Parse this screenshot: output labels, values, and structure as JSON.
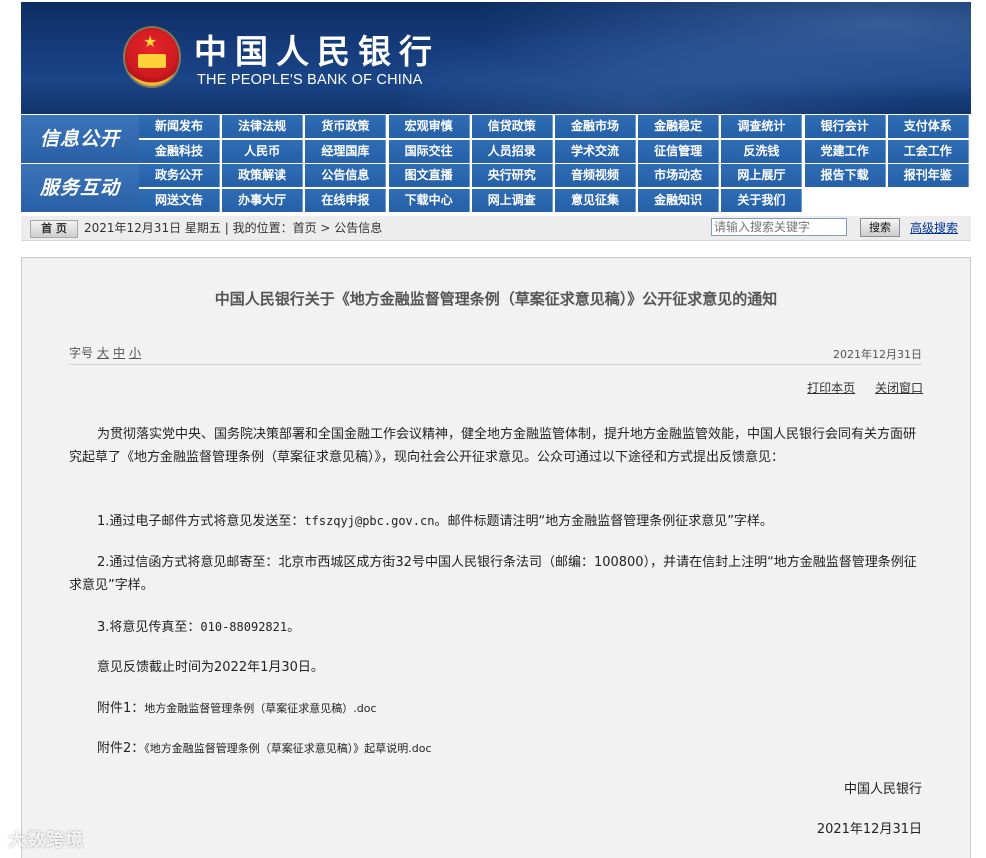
{
  "header": {
    "brand_cn": "中国人民银行",
    "brand_en": "THE PEOPLE'S BANK OF CHINA"
  },
  "nav": {
    "info_label": "信息公开",
    "service_label": "服务互动",
    "info_row1": [
      "新闻发布",
      "法律法规",
      "货币政策",
      "宏观审慎",
      "信贷政策",
      "金融市场",
      "金融稳定",
      "调查统计",
      "银行会计",
      "支付体系"
    ],
    "info_row2": [
      "金融科技",
      "人民币",
      "经理国库",
      "国际交往",
      "人员招录",
      "学术交流",
      "征信管理",
      "反洗钱",
      "党建工作",
      "工会工作"
    ],
    "service_row1": [
      "政务公开",
      "政策解读",
      "公告信息",
      "图文直播",
      "央行研究",
      "音频视频",
      "市场动态",
      "网上展厅",
      "报告下载",
      "报刊年鉴"
    ],
    "service_row2": [
      "网送文告",
      "办事大厅",
      "在线申报",
      "下载中心",
      "网上调查",
      "意见征集",
      "金融知识",
      "关于我们"
    ]
  },
  "breadcrumb": {
    "home": "首 页",
    "text": "2021年12月31日 星期五 | 我的位置：首页 > 公告信息",
    "search_placeholder": "请输入搜索关键字",
    "search_button": "搜索",
    "advanced": "高级搜索"
  },
  "article": {
    "title": "中国人民银行关于《地方金融监督管理条例（草案征求意见稿）》公开征求意见的通知",
    "font_label": "字号",
    "font_sizes": [
      "大",
      "中",
      "小"
    ],
    "date": "2021年12月31日",
    "print": "打印本页",
    "close": "关闭窗口",
    "intro": "为贯彻落实党中央、国务院决策部署和全国金融工作会议精神，健全地方金融监管体制，提升地方金融监管效能，中国人民银行会同有关方面研究起草了《地方金融监督管理条例（草案征求意见稿）》，现向社会公开征求意见。公众可通过以下途径和方式提出反馈意见：",
    "item1_prefix": "1.通过电子邮件方式将意见发送至：",
    "item1_email": "tfszqyj@pbc.gov.cn",
    "item1_suffix": "。邮件标题请注明“地方金融监督管理条例征求意见”字样。",
    "item2": "2.通过信函方式将意见邮寄至：北京市西城区成方街32号中国人民银行条法司（邮编：100800），并请在信封上注明“地方金融监督管理条例征求意见”字样。",
    "item3_prefix": "3.将意见传真至：",
    "item3_fax": "010-88092821",
    "item3_suffix": "。",
    "deadline": "意见反馈截止时间为2022年1月30日。",
    "att1_label": "附件1：",
    "att1_file": "地方金融监督管理条例（草案征求意见稿）.doc",
    "att2_label": "附件2：",
    "att2_file": "《地方金融监督管理条例（草案征求意见稿）》起草说明.doc",
    "signature": "中国人民银行",
    "sign_date": "2021年12月31日"
  },
  "watermark": "大数跨境",
  "colors": {
    "banner": "#163d7d",
    "nav_button": "#2f6db5",
    "panel_bg": "#f2f2f2",
    "link": "#003399"
  }
}
